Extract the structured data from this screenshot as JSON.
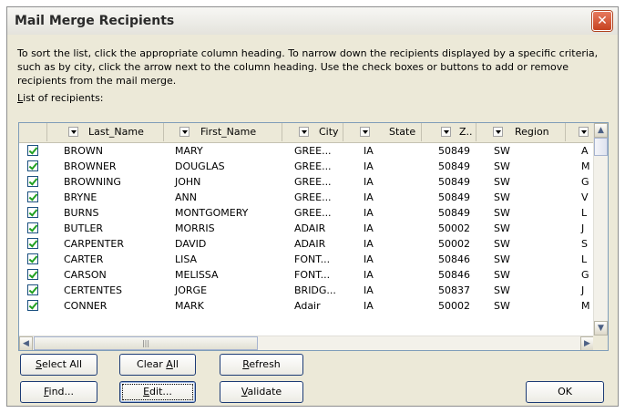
{
  "window": {
    "title": "Mail Merge Recipients",
    "close_glyph": "✕"
  },
  "instructions": "To sort the list, click the appropriate column heading.  To narrow down the recipients displayed by a specific criteria, such as by city, click the arrow next to the column heading.  Use the check boxes or buttons to add or remove recipients from the mail merge.",
  "list_label": {
    "mnemonic": "L",
    "rest": "ist of recipients:"
  },
  "columns": [
    "Last_Name",
    "First_Name",
    "City",
    "State",
    "Z..",
    "Region",
    ""
  ],
  "rows": [
    {
      "last": "BROWN",
      "first": "MARY",
      "city": "GREE...",
      "state": "IA",
      "zip": "50849",
      "region": "SW",
      "extra": "A"
    },
    {
      "last": "BROWNER",
      "first": "DOUGLAS",
      "city": "GREE...",
      "state": "IA",
      "zip": "50849",
      "region": "SW",
      "extra": "M"
    },
    {
      "last": "BROWNING",
      "first": "JOHN",
      "city": "GREE...",
      "state": "IA",
      "zip": "50849",
      "region": "SW",
      "extra": "G"
    },
    {
      "last": "BRYNE",
      "first": "ANN",
      "city": "GREE...",
      "state": "IA",
      "zip": "50849",
      "region": "SW",
      "extra": "V"
    },
    {
      "last": "BURNS",
      "first": "MONTGOMERY",
      "city": "GREE...",
      "state": "IA",
      "zip": "50849",
      "region": "SW",
      "extra": "L"
    },
    {
      "last": "BUTLER",
      "first": "MORRIS",
      "city": "ADAIR",
      "state": "IA",
      "zip": "50002",
      "region": "SW",
      "extra": "J"
    },
    {
      "last": "CARPENTER",
      "first": "DAVID",
      "city": "ADAIR",
      "state": "IA",
      "zip": "50002",
      "region": "SW",
      "extra": "S"
    },
    {
      "last": "CARTER",
      "first": "LISA",
      "city": "FONT...",
      "state": "IA",
      "zip": "50846",
      "region": "SW",
      "extra": "L"
    },
    {
      "last": "CARSON",
      "first": "MELISSA",
      "city": "FONT...",
      "state": "IA",
      "zip": "50846",
      "region": "SW",
      "extra": "G"
    },
    {
      "last": "CERTENTES",
      "first": "JORGE",
      "city": "BRIDG...",
      "state": "IA",
      "zip": "50837",
      "region": "SW",
      "extra": "J"
    },
    {
      "last": "CONNER",
      "first": "MARK",
      "city": "Adair",
      "state": "IA",
      "zip": "50002",
      "region": "SW",
      "extra": "M"
    }
  ],
  "scroll": {
    "up": "▲",
    "down": "▼",
    "left": "◀",
    "right": "▶",
    "thumb_grip": "|||"
  },
  "buttons": {
    "select_all": {
      "mnemonic": "S",
      "rest": "elect All"
    },
    "clear_all": {
      "pre": "Clear ",
      "mnemonic": "A",
      "rest": "ll"
    },
    "refresh": {
      "mnemonic": "R",
      "rest": "efresh"
    },
    "find": {
      "mnemonic": "F",
      "rest": "ind..."
    },
    "edit": {
      "mnemonic": "E",
      "rest": "dit..."
    },
    "validate": {
      "mnemonic": "V",
      "rest": "alidate"
    },
    "ok": "OK"
  }
}
